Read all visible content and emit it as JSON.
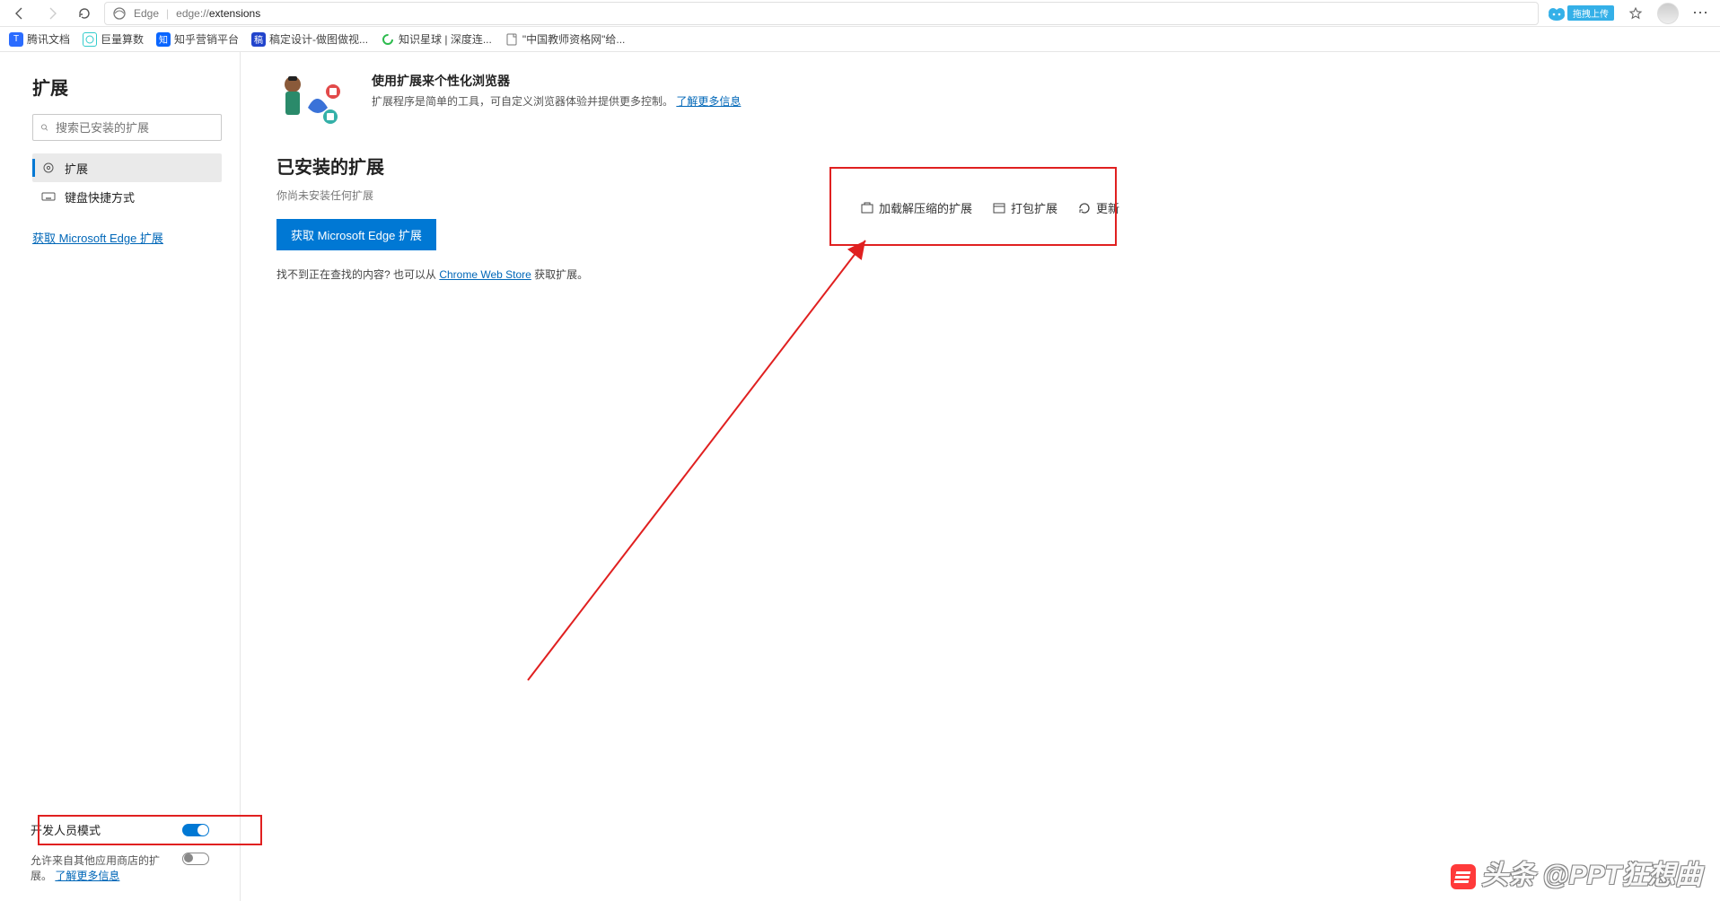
{
  "browser": {
    "brand": "Edge",
    "url_scheme": "edge://",
    "url_path": "extensions",
    "upload_tag": "拖拽上传"
  },
  "bookmarks": [
    {
      "label": "腾讯文档"
    },
    {
      "label": "巨量算数"
    },
    {
      "label": "知乎营销平台"
    },
    {
      "label": "稿定设计-做图做视..."
    },
    {
      "label": "知识星球 | 深度连..."
    },
    {
      "label": "\"中国教师资格网\"给..."
    }
  ],
  "sidebar": {
    "title": "扩展",
    "search_placeholder": "搜索已安装的扩展",
    "items": [
      {
        "label": "扩展"
      },
      {
        "label": "键盘快捷方式"
      }
    ],
    "get_extensions": "获取 Microsoft Edge 扩展",
    "dev_mode_label": "开发人员模式",
    "allow_other_prefix": "允许来自其他应用商店的扩展。",
    "allow_other_link": "了解更多信息"
  },
  "content": {
    "hero_title": "使用扩展来个性化浏览器",
    "hero_sub": "扩展程序是简单的工具，可自定义浏览器体验并提供更多控制。",
    "hero_link": "了解更多信息",
    "installed_title": "已安装的扩展",
    "installed_sub": "你尚未安装任何扩展",
    "get_btn": "获取 Microsoft Edge 扩展",
    "cant_find_prefix": "找不到正在查找的内容? 也可以从 ",
    "cant_find_link": "Chrome Web Store",
    "cant_find_suffix": " 获取扩展。",
    "dev_actions": {
      "load": "加载解压缩的扩展",
      "pack": "打包扩展",
      "update": "更新"
    }
  },
  "watermark": "头条 @PPT狂想曲"
}
